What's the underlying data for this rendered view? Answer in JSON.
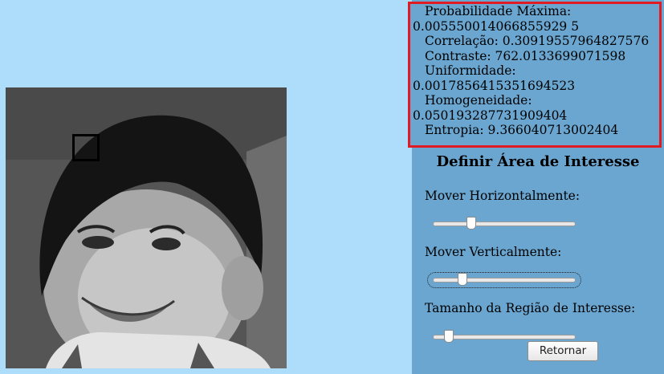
{
  "stats": {
    "max_prob_label": "Probabilidade Máxima:",
    "max_prob_value": "0.005550014066855929 5",
    "correlation": "Correlação: 0.30919557964827576",
    "contrast": "Contraste: 762.0133699071598",
    "uniformity_label": "Uniformidade:",
    "uniformity_value": "0.0017856415351694523",
    "homogeneity_label": "Homogeneidade:",
    "homogeneity_value": "0.050193287731909404",
    "entropy": "Entropia: 9.366040713002404"
  },
  "roi_panel": {
    "title": "Definir Área de Interesse",
    "horizontal_label": "Mover Horizontalmente:",
    "vertical_label": "Mover Verticalmente:",
    "size_label": "Tamanho da Região de Interesse:",
    "horizontal_value_pct": 26,
    "vertical_value_pct": 20,
    "size_value_pct": 10,
    "return_button": "Retornar"
  },
  "colors": {
    "background": "#aedcfb",
    "panel": "#6aa6d0",
    "highlight_border": "#e01b24"
  }
}
